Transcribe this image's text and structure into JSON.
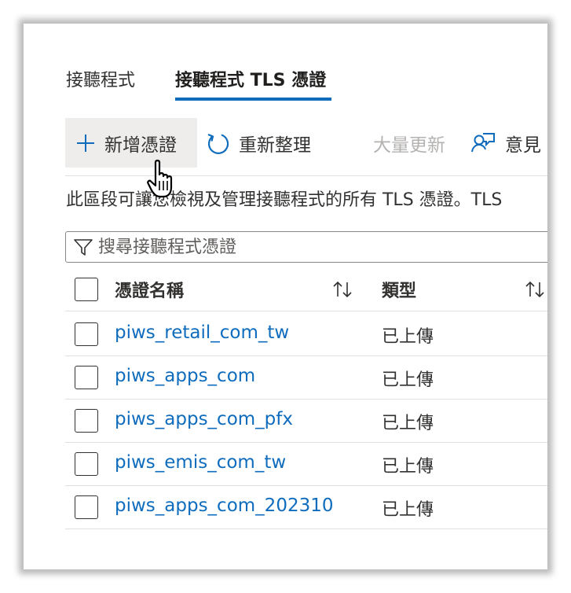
{
  "tabs": [
    {
      "label": "接聽程式",
      "active": false
    },
    {
      "label": "接聽程式 TLS 憑證",
      "active": true
    }
  ],
  "toolbar": {
    "add_label": "新增憑證",
    "refresh_label": "重新整理",
    "bulk_update_label": "大量更新",
    "feedback_label": "意見 l"
  },
  "description": "此區段可讓您檢視及管理接聽程式的所有 TLS 憑證。TLS",
  "search": {
    "placeholder": "搜尋接聽程式憑證",
    "value": ""
  },
  "table": {
    "columns": [
      "憑證名稱",
      "類型"
    ],
    "rows": [
      {
        "name": "piws_retail_com_tw",
        "type": "已上傳"
      },
      {
        "name": "piws_apps_com",
        "type": "已上傳"
      },
      {
        "name": "piws_apps_com_pfx",
        "type": "已上傳"
      },
      {
        "name": "piws_emis_com_tw",
        "type": "已上傳"
      },
      {
        "name": "piws_apps_com_202310",
        "type": "已上傳"
      }
    ]
  },
  "colors": {
    "accent": "#0f6cbd",
    "text": "#323130",
    "disabled": "#b4b2b0",
    "hover_bg": "#eeedec"
  },
  "icons": {
    "add": "plus-icon",
    "refresh": "refresh-icon",
    "feedback": "feedback-icon",
    "filter": "filter-icon",
    "sort": "sort-icon",
    "cursor": "hand-pointer-icon"
  }
}
